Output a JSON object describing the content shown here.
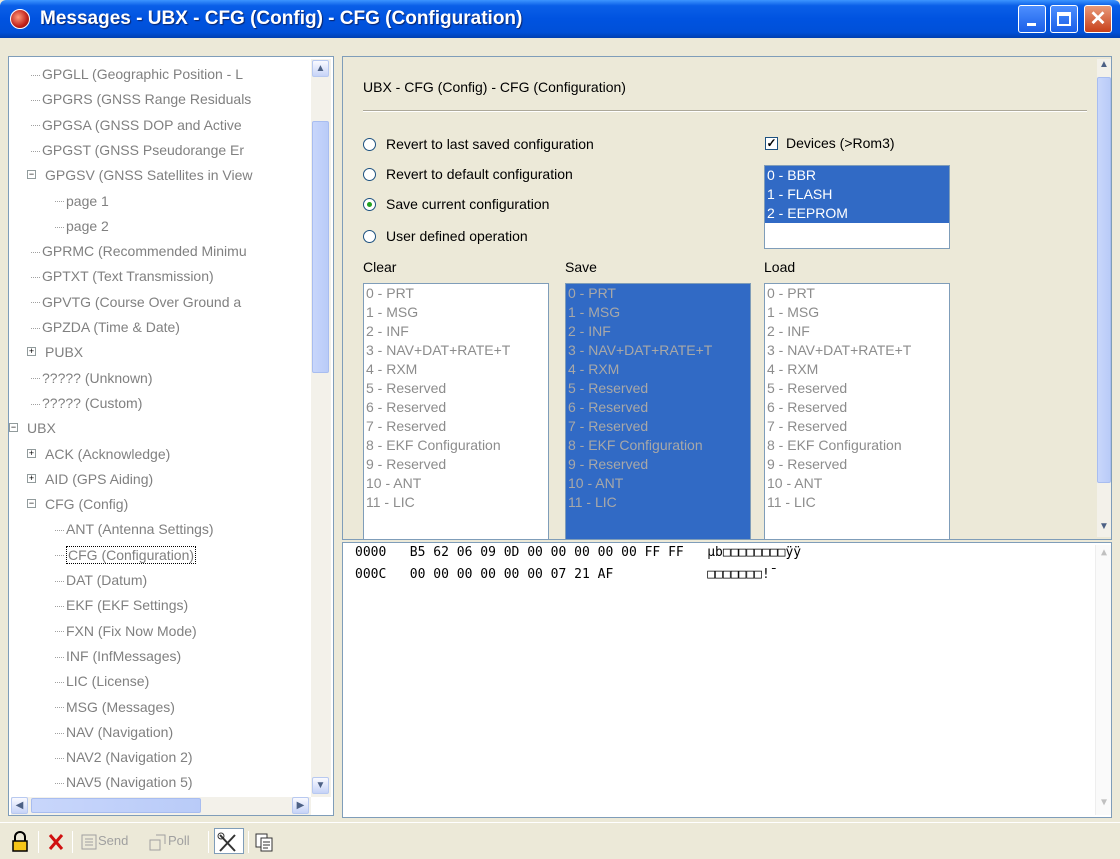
{
  "window": {
    "title": "Messages - UBX - CFG (Config) - CFG (Configuration)"
  },
  "tree": {
    "items": [
      {
        "label": "GPGLL (Geographic Position - L",
        "level": 2
      },
      {
        "label": "GPGRS (GNSS Range Residuals",
        "level": 2
      },
      {
        "label": "GPGSA (GNSS DOP and Active",
        "level": 2
      },
      {
        "label": "GPGST (GNSS Pseudorange Er",
        "level": 2
      },
      {
        "label": "GPGSV (GNSS Satellites in View",
        "level": 2
      },
      {
        "label": "page 1",
        "level": 3
      },
      {
        "label": "page 2",
        "level": 3
      },
      {
        "label": "GPRMC (Recommended Minimu",
        "level": 2
      },
      {
        "label": "GPTXT (Text Transmission)",
        "level": 2
      },
      {
        "label": "GPVTG (Course Over Ground a",
        "level": 2
      },
      {
        "label": "GPZDA (Time & Date)",
        "level": 2
      },
      {
        "label": "PUBX",
        "level": 2
      },
      {
        "label": "????? (Unknown)",
        "level": 2
      },
      {
        "label": "????? (Custom)",
        "level": 2
      },
      {
        "label": "UBX",
        "level": 1
      },
      {
        "label": "ACK (Acknowledge)",
        "level": 2
      },
      {
        "label": "AID (GPS Aiding)",
        "level": 2
      },
      {
        "label": "CFG (Config)",
        "level": 2
      },
      {
        "label": "ANT (Antenna Settings)",
        "level": 3
      },
      {
        "label": "CFG (Configuration)",
        "level": 3
      },
      {
        "label": "DAT (Datum)",
        "level": 3
      },
      {
        "label": "EKF (EKF Settings)",
        "level": 3
      },
      {
        "label": "FXN (Fix Now Mode)",
        "level": 3
      },
      {
        "label": "INF (InfMessages)",
        "level": 3
      },
      {
        "label": "LIC (License)",
        "level": 3
      },
      {
        "label": "MSG (Messages)",
        "level": 3
      },
      {
        "label": "NAV (Navigation)",
        "level": 3
      },
      {
        "label": "NAV2 (Navigation 2)",
        "level": 3
      },
      {
        "label": "NAV5 (Navigation 5)",
        "level": 3
      }
    ]
  },
  "config": {
    "heading": "UBX - CFG (Config) - CFG (Configuration)",
    "radios": [
      {
        "label": "Revert to last saved configuration",
        "checked": false
      },
      {
        "label": "Revert to default configuration",
        "checked": false
      },
      {
        "label": "Save current configuration",
        "checked": true
      },
      {
        "label": "User defined operation",
        "checked": false
      }
    ],
    "devices_label": "Devices (>Rom3)",
    "devices_checked": true,
    "devices": [
      "0 - BBR",
      "1 - FLASH",
      "2 - EEPROM"
    ],
    "clear_label": "Clear",
    "save_label": "Save",
    "load_label": "Load",
    "sections": [
      "0 - PRT",
      "1 - MSG",
      "2 - INF",
      "3 - NAV+DAT+RATE+T",
      "4 - RXM",
      "5 - Reserved",
      "6 - Reserved",
      "7 - Reserved",
      "8 - EKF Configuration",
      "9 - Reserved",
      "10 - ANT",
      "11 - LIC"
    ]
  },
  "hex": {
    "rows": [
      {
        "offset": "0000",
        "bytes": "B5 62 06 09 0D 00 00 00 00 00 FF FF",
        "ascii": "µb□□□□□□□□ÿÿ"
      },
      {
        "offset": "000C",
        "bytes": "00 00 00 00 00 00 07 21 AF",
        "ascii": "□□□□□□□!¯"
      }
    ]
  },
  "toolbar": {
    "send_label": "Send",
    "poll_label": "Poll"
  }
}
